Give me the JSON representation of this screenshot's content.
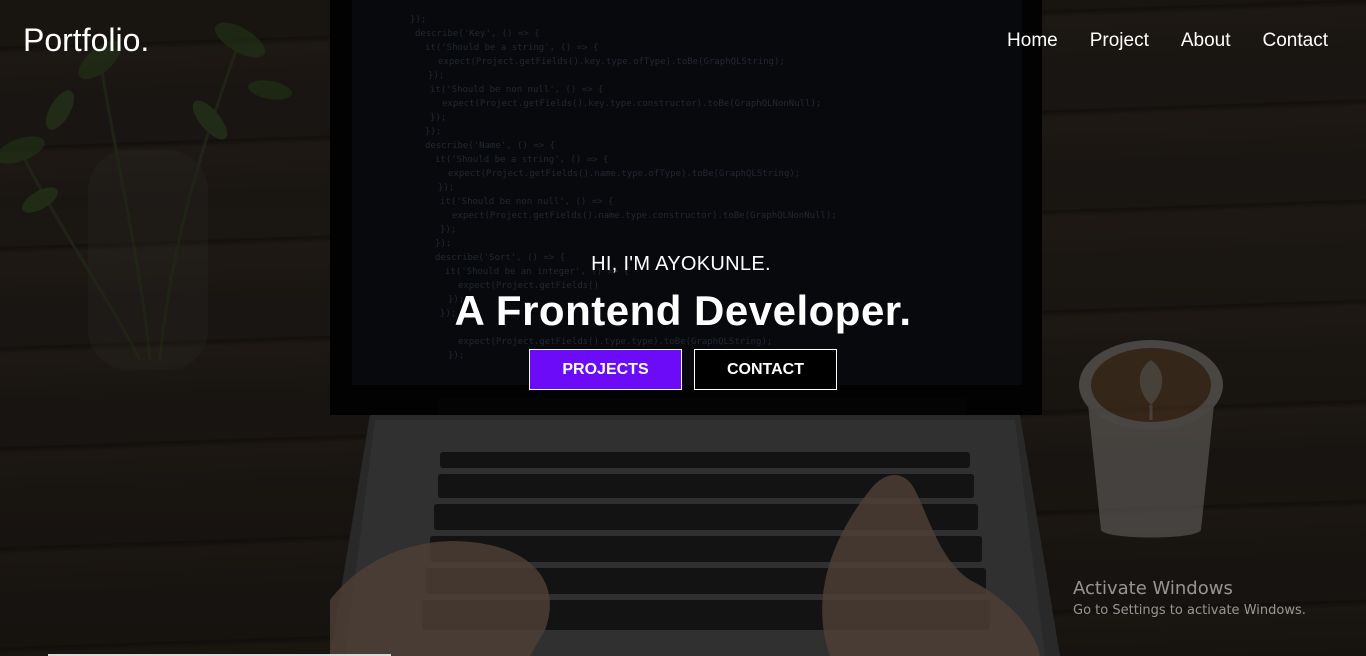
{
  "header": {
    "logo": "Portfolio.",
    "nav": [
      "Home",
      "Project",
      "About",
      "Contact"
    ]
  },
  "hero": {
    "greeting": "HI, I'M AYOKUNLE.",
    "headline": "A Frontend Developer.",
    "buttons": {
      "projects": "PROJECTS",
      "contact": "CONTACT"
    }
  },
  "watermark": {
    "title": "Activate Windows",
    "subtitle": "Go to Settings to activate Windows."
  },
  "colors": {
    "accent": "#6c0bf7",
    "text": "#ffffff",
    "contact_button_bg": "#000000"
  },
  "background": {
    "description_icons": [
      "plant-image",
      "laptop-image",
      "coffee-cup-image"
    ]
  }
}
